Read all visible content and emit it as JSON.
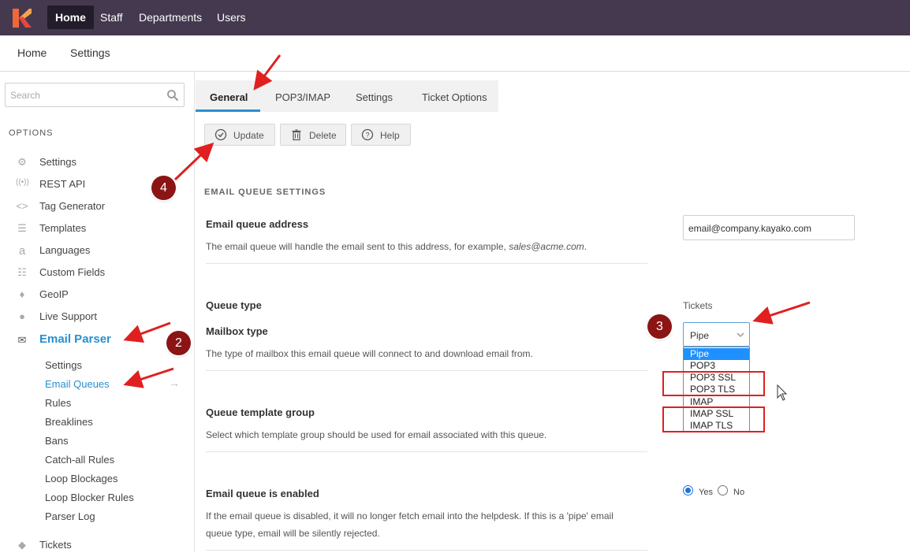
{
  "topbar": {
    "nav": [
      "Home",
      "Staff",
      "Departments",
      "Users"
    ],
    "active": "Home"
  },
  "subbar": {
    "items": [
      "Home",
      "Settings"
    ]
  },
  "sidebar": {
    "search_placeholder": "Search",
    "section_label": "OPTIONS",
    "items": [
      {
        "label": "Settings",
        "icon": "gear-icon"
      },
      {
        "label": "REST API",
        "icon": "broadcast-icon"
      },
      {
        "label": "Tag Generator",
        "icon": "code-icon"
      },
      {
        "label": "Templates",
        "icon": "list-icon"
      },
      {
        "label": "Languages",
        "icon": "language-icon"
      },
      {
        "label": "Custom Fields",
        "icon": "fields-icon"
      },
      {
        "label": "GeoIP",
        "icon": "pin-icon"
      },
      {
        "label": "Live Support",
        "icon": "chat-icon"
      },
      {
        "label": "Email Parser",
        "icon": "envelope-icon"
      }
    ],
    "sub_items": [
      "Settings",
      "Email Queues",
      "Rules",
      "Breaklines",
      "Bans",
      "Catch-all Rules",
      "Loop Blockages",
      "Loop Blocker Rules",
      "Parser Log"
    ],
    "sub_active_arrow": "→",
    "bottom_item": {
      "label": "Tickets",
      "icon": "tag-icon"
    }
  },
  "tabs": [
    "General",
    "POP3/IMAP",
    "Settings",
    "Ticket Options"
  ],
  "toolbar": {
    "update": "Update",
    "delete": "Delete",
    "help": "Help"
  },
  "section_title": "EMAIL QUEUE SETTINGS",
  "fields": {
    "address": {
      "label": "Email queue address",
      "desc_prefix": "The email queue will handle the email sent to this address, for example, ",
      "desc_example": "sales@acme.com",
      "desc_suffix": ".",
      "value": "email@company.kayako.com"
    },
    "queue_type": {
      "label": "Queue type",
      "value": "Tickets"
    },
    "mailbox_type": {
      "label": "Mailbox type",
      "desc": "The type of mailbox this email queue will connect to and download email from.",
      "selected": "Pipe",
      "options": [
        "Pipe",
        "POP3",
        "POP3 SSL",
        "POP3 TLS",
        "IMAP",
        "IMAP SSL",
        "IMAP TLS"
      ]
    },
    "template_group": {
      "label": "Queue template group",
      "desc": "Select which template group should be used for email associated with this queue."
    },
    "enabled": {
      "label": "Email queue is enabled",
      "desc_line1": "If the email queue is disabled, it will no longer fetch email into the helpdesk. If this is a 'pipe' email",
      "desc_line2": "queue type, email will be silently rejected.",
      "yes": "Yes",
      "no": "No",
      "value": "Yes"
    }
  },
  "annotations": {
    "badges": [
      "2",
      "3",
      "4"
    ]
  },
  "colors": {
    "topbar": "#44394f",
    "accent": "#2a8fcf",
    "annotation_red": "#e02020",
    "badge": "#8b1515"
  }
}
